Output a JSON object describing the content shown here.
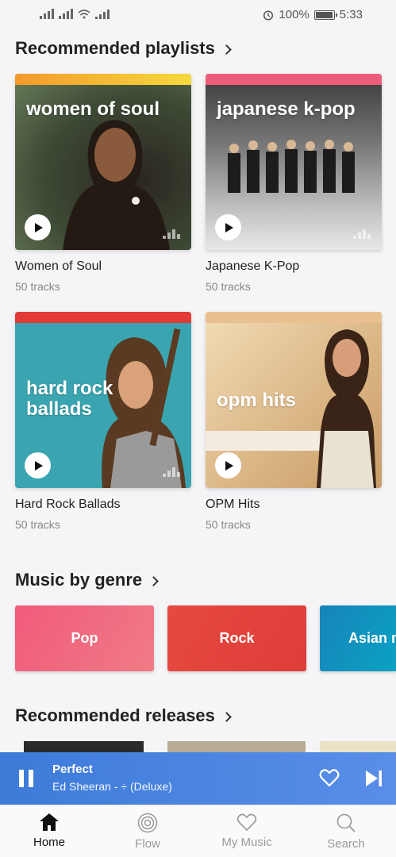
{
  "status": {
    "battery": "100%",
    "time": "5:33",
    "battery_level": 1.0
  },
  "sections": {
    "playlists_title": "Recommended playlists",
    "genre_title": "Music by genre",
    "releases_title": "Recommended releases"
  },
  "playlists": [
    {
      "art_text": "women of soul",
      "title": "Women of Soul",
      "tracks": "50 tracks",
      "stripe": "#f6c934",
      "bg": "#4a5a3e"
    },
    {
      "art_text": "japanese k-pop",
      "title": "Japanese K-Pop",
      "tracks": "50 tracks",
      "stripe": "#ef5b7a",
      "bg": "#5a5a5a"
    },
    {
      "art_text": "hard rock ballads",
      "title": "Hard Rock Ballads",
      "tracks": "50 tracks",
      "stripe": "#e23a36",
      "bg": "#3aa5b0"
    },
    {
      "art_text": "opm hits",
      "title": "OPM Hits",
      "tracks": "50 tracks",
      "stripe": "#e9c08f",
      "bg": "#d9b482"
    }
  ],
  "genres": [
    {
      "label": "Pop",
      "color": "#ef5f7a"
    },
    {
      "label": "Rock",
      "color": "#e2463e"
    },
    {
      "label": "Asian m",
      "color": "#1a8fb8"
    }
  ],
  "player": {
    "track": "Perfect",
    "artist": "Ed Sheeran - ÷ (Deluxe)"
  },
  "nav": [
    {
      "label": "Home",
      "icon": "home-icon",
      "active": true
    },
    {
      "label": "Flow",
      "icon": "flow-icon",
      "active": false
    },
    {
      "label": "My Music",
      "icon": "heart-icon",
      "active": false
    },
    {
      "label": "Search",
      "icon": "search-icon",
      "active": false
    }
  ]
}
